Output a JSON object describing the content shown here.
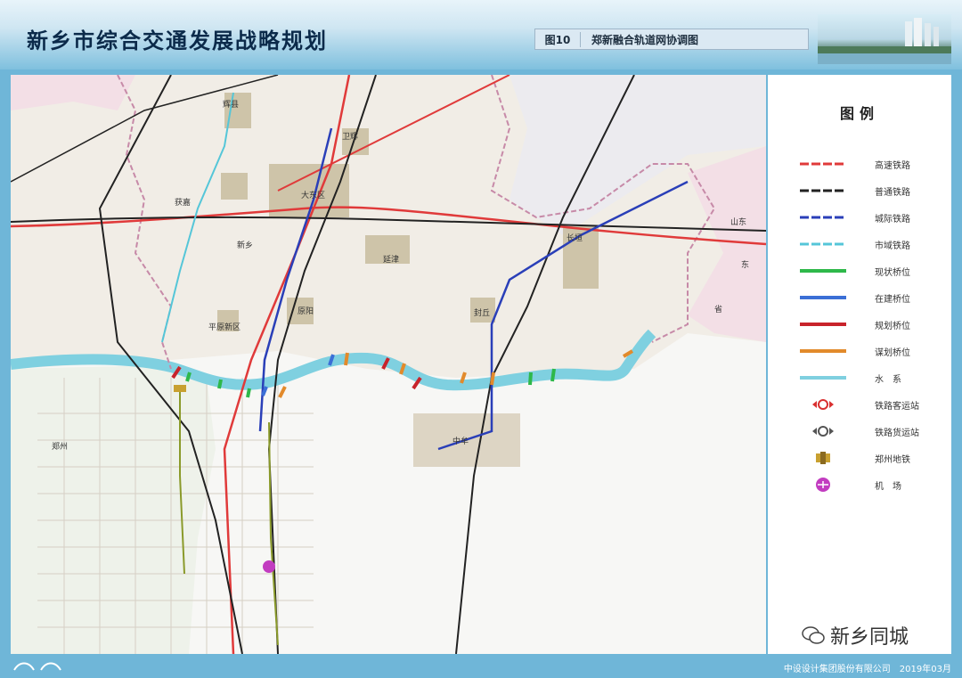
{
  "header": {
    "title": "新乡市综合交通发展战略规划",
    "figure_number": "图10",
    "figure_title": "郑新融合轨道网协调图"
  },
  "legend": {
    "title": "图例",
    "items": [
      {
        "label": "高速铁路",
        "symbol": "hsr-line",
        "color": "#e03a3a"
      },
      {
        "label": "普通铁路",
        "symbol": "rail-line",
        "color": "#222222"
      },
      {
        "label": "城际铁路",
        "symbol": "intercity-line",
        "color": "#2a3fb8"
      },
      {
        "label": "市域铁路",
        "symbol": "suburban-line",
        "color": "#55c6d8"
      },
      {
        "label": "现状桥位",
        "symbol": "bar",
        "color": "#2eb84a"
      },
      {
        "label": "在建桥位",
        "symbol": "bar",
        "color": "#3b6fd6"
      },
      {
        "label": "规划桥位",
        "symbol": "bar",
        "color": "#c8232b"
      },
      {
        "label": "谋划桥位",
        "symbol": "bar",
        "color": "#e28a2b"
      },
      {
        "label": "水　系",
        "symbol": "bar",
        "color": "#7fd0e0"
      },
      {
        "label": "铁路客运站",
        "symbol": "passenger-station-icon",
        "color": "#d93030"
      },
      {
        "label": "铁路货运站",
        "symbol": "freight-station-icon",
        "color": "#555555"
      },
      {
        "label": "郑州地铁",
        "symbol": "metro-icon",
        "color": "#c8a030"
      },
      {
        "label": "机　场",
        "symbol": "airport-icon",
        "color": "#c23cc0"
      }
    ]
  },
  "map": {
    "labels": [
      "辉县",
      "卫辉",
      "获嘉",
      "大东区",
      "新乡",
      "延津",
      "原阳",
      "长垣",
      "平原新区",
      "封丘",
      "中牟",
      "郑州",
      "山东",
      "东",
      "省"
    ]
  },
  "footer": {
    "credit": "中设设计集团股份有限公司　2019年03月"
  },
  "watermark": {
    "text": "新乡同城"
  }
}
